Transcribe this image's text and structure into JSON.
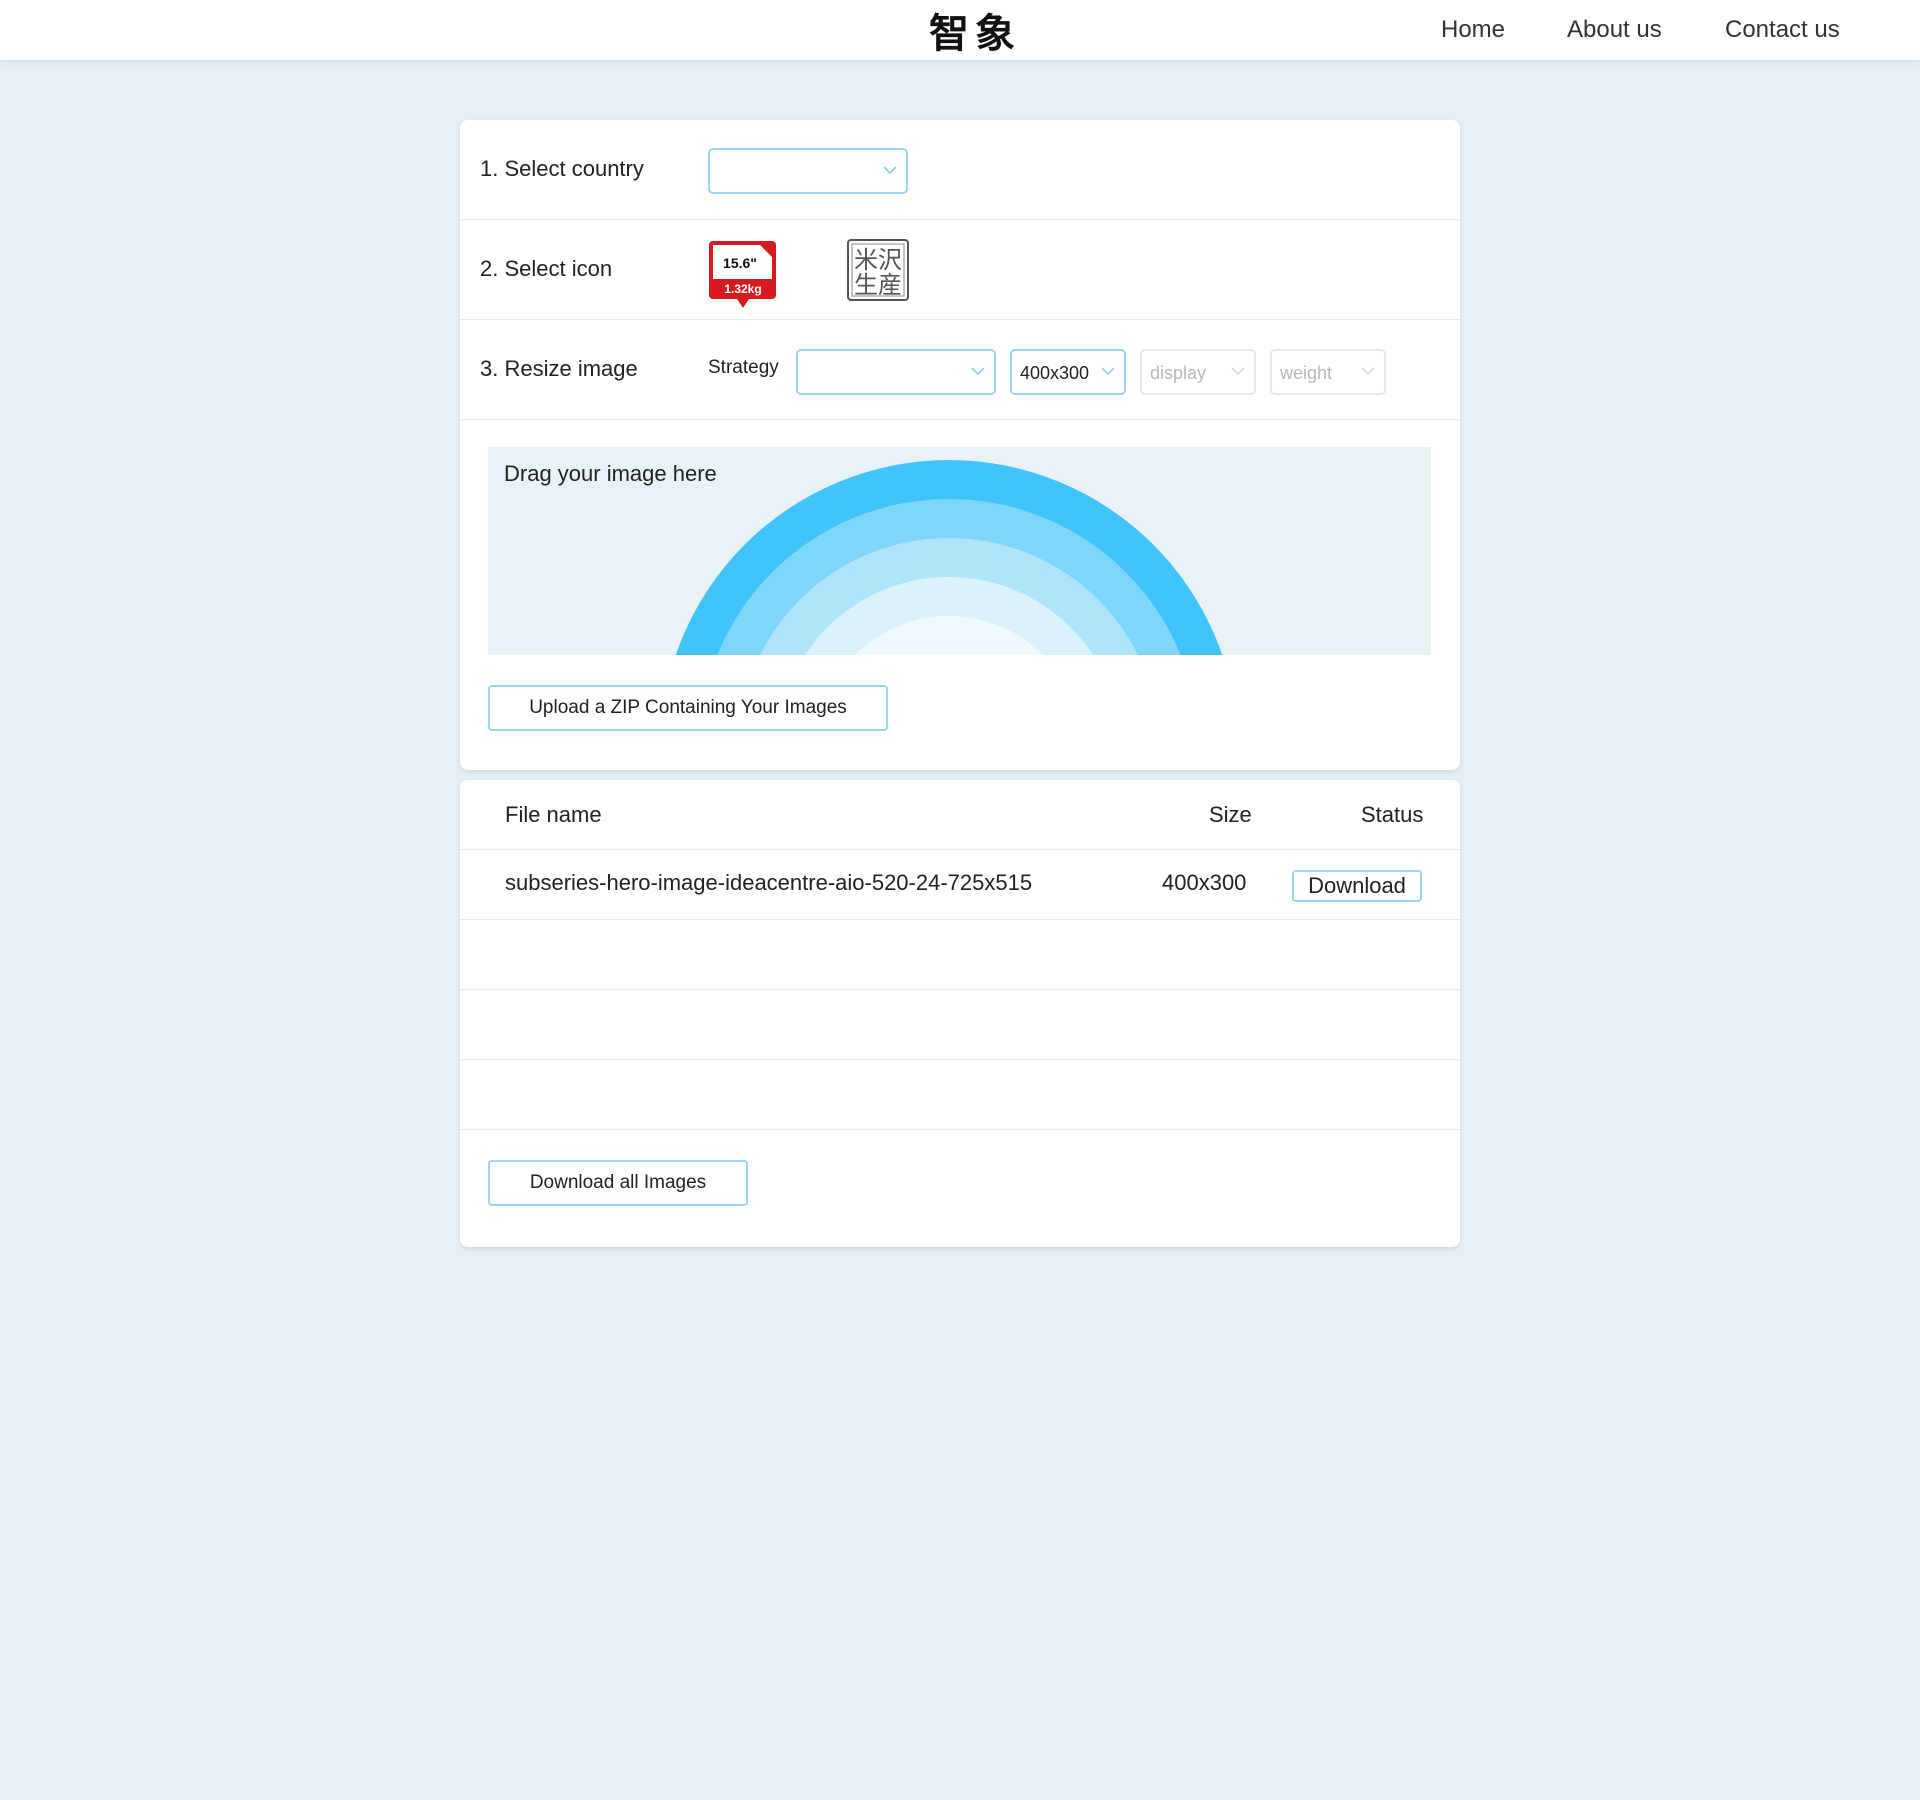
{
  "header": {
    "brand": "智象",
    "nav": {
      "home": "Home",
      "about": "About us",
      "contact": "Contact us"
    }
  },
  "form": {
    "country": {
      "label": "1. Select country",
      "value": ""
    },
    "icon": {
      "label": "2. Select icon",
      "options": [
        {
          "name": "laptop-spec-badge",
          "size_text": "15.6\"",
          "weight_text": "1.32kg"
        },
        {
          "name": "yonezawa-stamp",
          "line1": "米沢",
          "line2": "生産"
        }
      ]
    },
    "resize": {
      "label": "3. Resize image",
      "strategy_label": "Strategy",
      "strategy_value": "",
      "size_value": "400x300",
      "display_placeholder": "display",
      "weight_placeholder": "weight"
    },
    "dropzone_hint": "Drag your image here",
    "upload_button": "Upload a ZIP Containing Your Images"
  },
  "files": {
    "headers": {
      "name": "File name",
      "size": "Size",
      "status": "Status"
    },
    "rows": [
      {
        "name": "subseries-hero-image-ideacentre-aio-520-24-725x515",
        "size": "400x300",
        "action": "Download"
      }
    ],
    "download_all": "Download all Images"
  },
  "colors": {
    "background": "#e6eff4",
    "accent_border": "#9ad7ef",
    "rainbow": [
      "#40c4fb",
      "#7fd6fb",
      "#afe4fb",
      "#d9f2fc",
      "#f0f9fd"
    ],
    "badge_red": "#d71920"
  }
}
